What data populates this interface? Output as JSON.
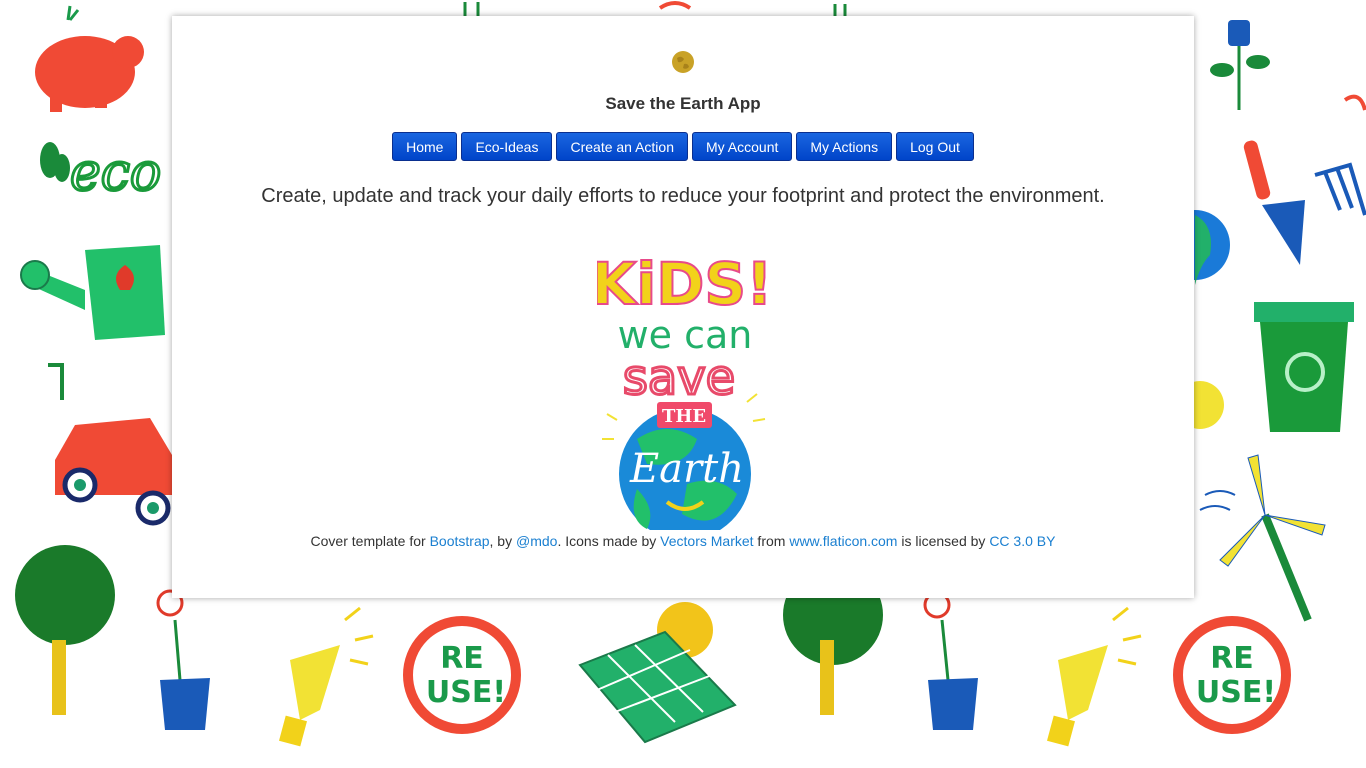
{
  "app": {
    "title": "Save the Earth App"
  },
  "nav": {
    "items": [
      {
        "label": "Home"
      },
      {
        "label": "Eco-Ideas"
      },
      {
        "label": "Create an Action"
      },
      {
        "label": "My Account"
      },
      {
        "label": "My Actions"
      },
      {
        "label": "Log Out"
      }
    ]
  },
  "lead": "Create, update and track your daily efforts to reduce your footprint and protect the environment.",
  "hero": {
    "line1": "KiDS!",
    "line2": "we can",
    "line3": "save",
    "line4": "THE",
    "line5": "Earth"
  },
  "background": {
    "reuse_line1": "RE",
    "reuse_line2": "USE!",
    "eco_text": "eco",
    "icons": [
      "piggy-bank-icon",
      "plug-plant-icon",
      "watering-can-icon",
      "electric-car-icon",
      "tree-icon",
      "flower-pot-icon",
      "light-bulb-icon",
      "reuse-icon",
      "solar-panel-icon",
      "trowel-icon",
      "fork-icon",
      "recycling-bin-icon",
      "wind-turbine-icon",
      "globe-icon"
    ]
  },
  "footer": {
    "prefix": "Cover template for ",
    "bootstrap": "Bootstrap",
    "by": ", by ",
    "mdo": "@mdo",
    "icons_text": ". Icons made by ",
    "vectors": "Vectors Market",
    "from": " from ",
    "flaticon": "www.flaticon.com",
    "licensed": " is licensed by ",
    "cc": "CC 3.0 BY"
  },
  "colors": {
    "nav_button": "#0a50d8",
    "link": "#1a7fd0",
    "text": "#333333",
    "earth_logo": "#c9a227"
  }
}
